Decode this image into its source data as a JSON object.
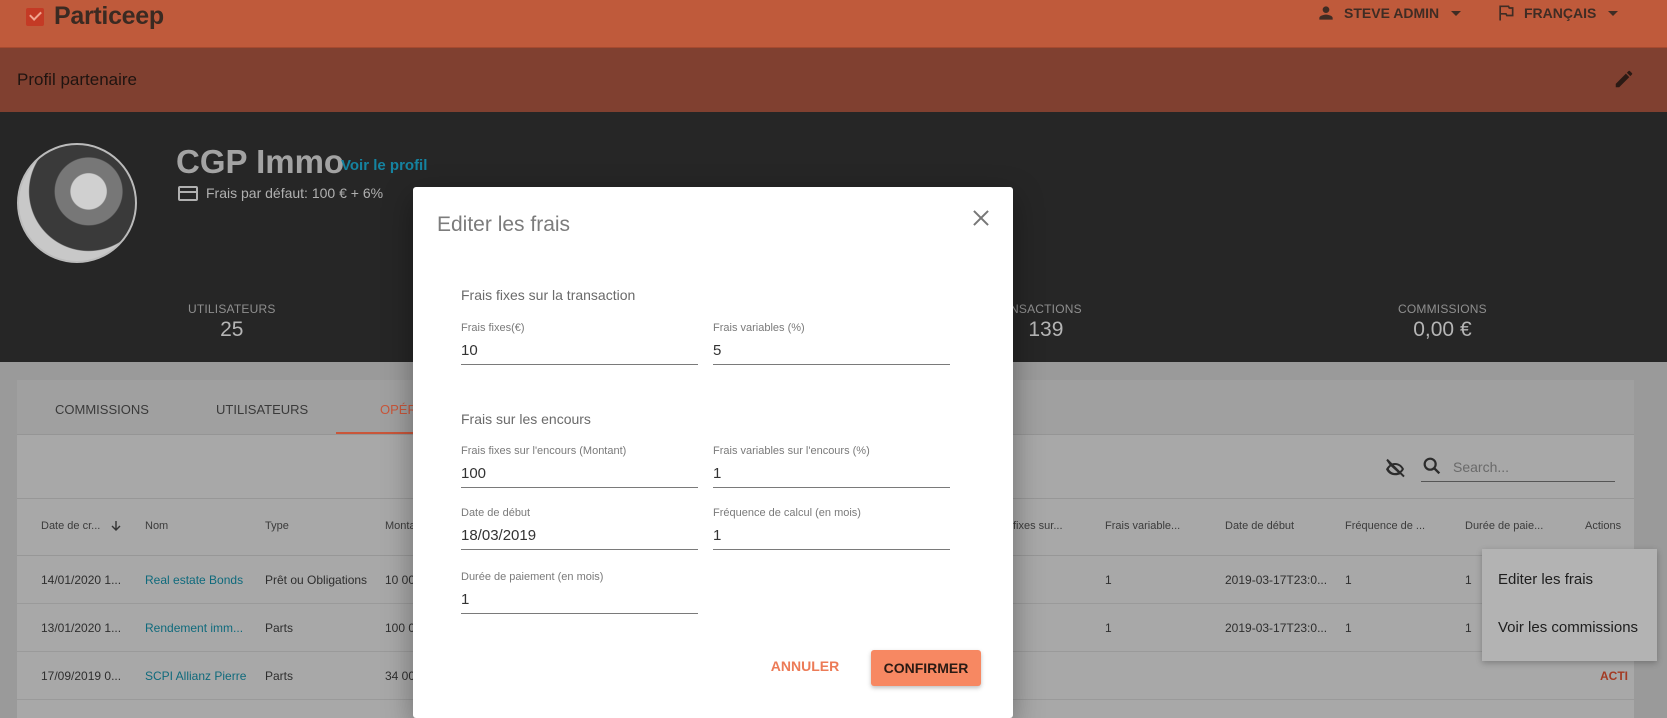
{
  "app": {
    "logo_text": "Particeep"
  },
  "header": {
    "user_label": "STEVE ADMIN",
    "language_label": "FRANÇAIS"
  },
  "subheader": {
    "title": "Profil partenaire"
  },
  "profile": {
    "name": "CGP Immo",
    "view_link": "Voir le profil",
    "default_fees": "Frais par défaut: 100 € + 6%"
  },
  "stats": [
    {
      "label": "UTILISATEURS",
      "value": "25"
    },
    {
      "label": "NSACTIONS",
      "value": "139"
    },
    {
      "label": "COMMISSIONS",
      "value": "0,00 €"
    }
  ],
  "tabs": [
    {
      "label": "COMMISSIONS"
    },
    {
      "label": "UTILISATEURS"
    },
    {
      "label": "OPÉRA"
    }
  ],
  "search": {
    "placeholder": "Search..."
  },
  "table": {
    "headers": [
      "Date de cr...",
      "Nom",
      "Type",
      "Monta",
      "fixes sur...",
      "Frais variable...",
      "Date de début",
      "Fréquence de ...",
      "Durée de paie...",
      "Actions"
    ],
    "rows": [
      {
        "date": "14/01/2020 1...",
        "name": "Real estate Bonds",
        "type": "Prêt ou Obligations",
        "amount": "10 00",
        "var": "1",
        "start": "2019-03-17T23:0...",
        "freq": "1",
        "dur": "1"
      },
      {
        "date": "13/01/2020 1...",
        "name": "Rendement imm...",
        "type": "Parts",
        "amount": "100 0",
        "var": "1",
        "start": "2019-03-17T23:0...",
        "freq": "1",
        "dur": "1"
      },
      {
        "date": "17/09/2019 0...",
        "name": "SCPI Allianz Pierre",
        "type": "Parts",
        "amount": "34 00",
        "action": "ACTI"
      }
    ]
  },
  "context_menu": {
    "items": [
      "Editer les frais",
      "Voir les commissions"
    ]
  },
  "modal": {
    "title": "Editer les frais",
    "section_transaction": "Frais fixes sur la transaction",
    "fixed_fee_label": "Frais fixes(€)",
    "fixed_fee_value": "10",
    "variable_fee_label": "Frais variables (%)",
    "variable_fee_value": "5",
    "section_outstanding": "Frais sur les encours",
    "outstanding_fixed_label": "Frais fixes sur l'encours (Montant)",
    "outstanding_fixed_value": "100",
    "outstanding_variable_label": "Frais variables sur l'encours (%)",
    "outstanding_variable_value": "1",
    "start_date_label": "Date de début",
    "start_date_value": "18/03/2019",
    "frequency_label": "Fréquence de calcul (en mois)",
    "frequency_value": "1",
    "duration_label": "Durée de paiement (en mois)",
    "duration_value": "1",
    "cancel_label": "ANNULER",
    "confirm_label": "CONFIRMER"
  }
}
